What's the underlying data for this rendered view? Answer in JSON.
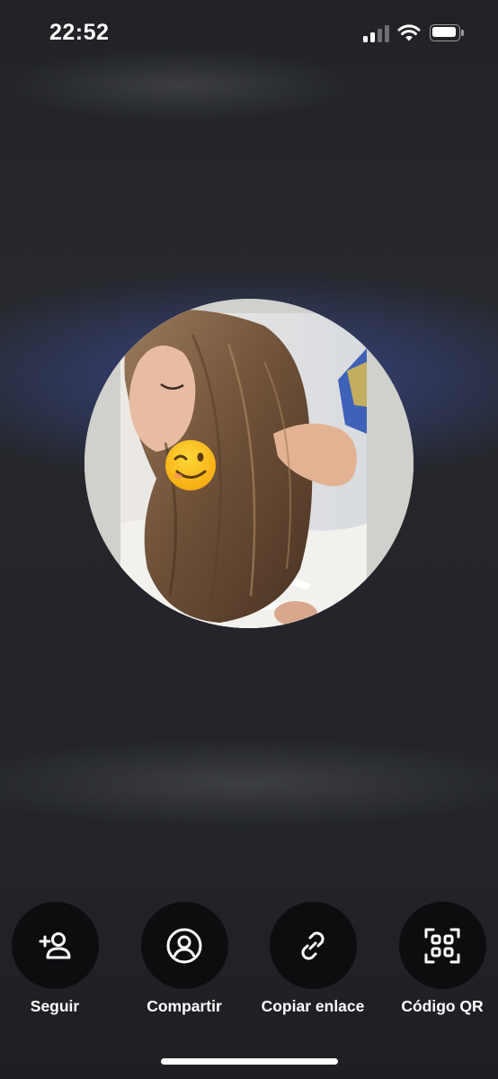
{
  "status_bar": {
    "time": "22:52",
    "signal_icon": "cellular-signal-icon",
    "wifi_icon": "wifi-icon",
    "battery_icon": "battery-icon",
    "signal_bars": 4,
    "signal_bars_filled": 2
  },
  "profile": {
    "avatar": "profile-photo",
    "overlay_emoji": "😉"
  },
  "actions": [
    {
      "label": "Seguir",
      "icon": "add-user-icon"
    },
    {
      "label": "Compartir",
      "icon": "user-circle-icon"
    },
    {
      "label": "Copiar enlace",
      "icon": "link-icon"
    },
    {
      "label": "Código QR",
      "icon": "qr-scan-icon"
    }
  ],
  "colors": {
    "background": "#25272b",
    "accent_glow": "#3a4a96",
    "button_bg": "#0c0d0f",
    "text": "#ffffff"
  }
}
